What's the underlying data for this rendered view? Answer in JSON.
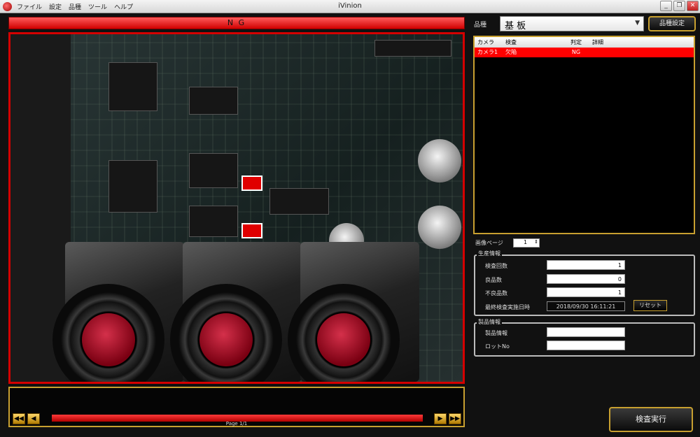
{
  "titlebar": {
    "title": "iVinion",
    "menu": [
      "ファイル",
      "設定",
      "品種",
      "ツール",
      "ヘルプ"
    ],
    "buttons": {
      "minimize": "_",
      "restore": "❐",
      "close": "✕"
    }
  },
  "viewer": {
    "status_banner": "N G",
    "page_label": "Page 1/1",
    "nav": {
      "first": "◀◀",
      "prev": "◀",
      "next": "▶",
      "last": "▶▶"
    }
  },
  "right_panel": {
    "hinshu_label": "品種",
    "hinshu_value": "基 板",
    "hinshu_settings_button": "品種設定",
    "results": {
      "headers": [
        "カメラ",
        "検査",
        "判定",
        "詳細"
      ],
      "rows": [
        {
          "camera": "カメラ1",
          "inspection": "欠陥",
          "judgment": "NG",
          "detail": ""
        }
      ]
    },
    "image_page_label": "画像ページ",
    "image_page_value": "1",
    "production": {
      "title": "生産情報",
      "inspection_count_label": "検査回数",
      "inspection_count": "1",
      "good_label": "良品数",
      "good": "0",
      "defective_label": "不良品数",
      "defective": "1",
      "last_inspection_label": "最終検査実施日時",
      "last_inspection": "2018/09/30 16:11:21",
      "reset_button": "リセット"
    },
    "product": {
      "title": "製品情報",
      "product_info_label": "製品情報",
      "product_info": "",
      "lot_label": "ロットNo",
      "lot": ""
    },
    "run_button": "検査実行"
  },
  "colors": {
    "ng_red": "#e00000",
    "frame_gold": "#c8a030"
  }
}
